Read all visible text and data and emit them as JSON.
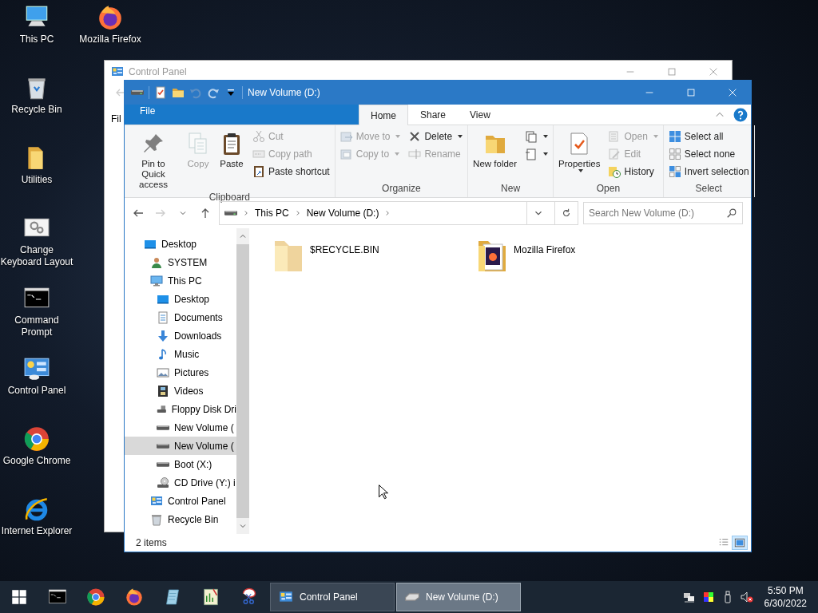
{
  "desktop_icons": [
    {
      "label": "This PC"
    },
    {
      "label": "Recycle Bin"
    },
    {
      "label": "Utilities"
    },
    {
      "label": "Change Keyboard Layout"
    },
    {
      "label": "Command Prompt"
    },
    {
      "label": "Control Panel"
    },
    {
      "label": "Google Chrome"
    },
    {
      "label": "Internet Explorer"
    },
    {
      "label": "Mozilla Firefox"
    }
  ],
  "background_window": {
    "title": "Control Panel",
    "menu_item": "Fil"
  },
  "window": {
    "title": "New Volume (D:)",
    "ribbon": {
      "tabs": [
        {
          "label": "File",
          "kind": "file",
          "selected": false
        },
        {
          "label": "Home",
          "kind": "tab",
          "selected": true
        },
        {
          "label": "Share",
          "kind": "tab",
          "selected": false
        },
        {
          "label": "View",
          "kind": "tab",
          "selected": false
        }
      ],
      "groups": [
        {
          "label": "Clipboard",
          "columns": [
            [
              {
                "label": "Pin to Quick access",
                "kind": "large",
                "disabled": false,
                "menu": false
              }
            ],
            [
              {
                "label": "Copy",
                "kind": "large",
                "disabled": true,
                "menu": false
              }
            ],
            [
              {
                "label": "Paste",
                "kind": "large",
                "disabled": false,
                "menu": false
              }
            ],
            [
              {
                "label": "Cut",
                "kind": "small",
                "disabled": true,
                "menu": false
              },
              {
                "label": "Copy path",
                "kind": "small",
                "disabled": true,
                "menu": false
              },
              {
                "label": "Paste shortcut",
                "kind": "small",
                "disabled": false,
                "menu": false
              }
            ]
          ]
        },
        {
          "label": "Organize",
          "columns": [
            [
              {
                "label": "Move to",
                "kind": "small",
                "disabled": true,
                "menu": true
              },
              {
                "label": "Copy to",
                "kind": "small",
                "disabled": true,
                "menu": true
              }
            ],
            [
              {
                "label": "Delete",
                "kind": "small",
                "disabled": false,
                "menu": true
              },
              {
                "label": "Rename",
                "kind": "small",
                "disabled": true,
                "menu": false
              }
            ]
          ]
        },
        {
          "label": "New",
          "columns": [
            [
              {
                "label": "New folder",
                "kind": "large",
                "disabled": false,
                "menu": false
              }
            ],
            [
              {
                "kind": "icon",
                "disabled": false,
                "menu": true
              },
              {
                "kind": "icon",
                "disabled": false,
                "menu": true
              }
            ]
          ]
        },
        {
          "label": "Open",
          "columns": [
            [
              {
                "label": "Properties",
                "kind": "large",
                "disabled": false,
                "menu": true
              }
            ],
            [
              {
                "label": "Open",
                "kind": "small",
                "disabled": true,
                "menu": true
              },
              {
                "label": "Edit",
                "kind": "small",
                "disabled": true,
                "menu": false
              },
              {
                "label": "History",
                "kind": "small",
                "disabled": false,
                "menu": false
              }
            ]
          ]
        },
        {
          "label": "Select",
          "columns": [
            [
              {
                "label": "Select all",
                "kind": "small",
                "disabled": false,
                "menu": false
              },
              {
                "label": "Select none",
                "kind": "small",
                "disabled": false,
                "menu": false
              },
              {
                "label": "Invert selection",
                "kind": "small",
                "disabled": false,
                "menu": false
              }
            ]
          ]
        }
      ]
    },
    "address": {
      "crumbs": [
        "This PC",
        "New Volume (D:)"
      ],
      "search": {
        "placeholder": "Search New Volume (D:)"
      }
    },
    "nav": {
      "items": [
        {
          "label": "Desktop",
          "selected": false,
          "children": [
            {
              "label": "SYSTEM",
              "selected": false
            },
            {
              "label": "This PC",
              "selected": false,
              "children": [
                {
                  "label": "Desktop",
                  "selected": false
                },
                {
                  "label": "Documents",
                  "selected": false
                },
                {
                  "label": "Downloads",
                  "selected": false
                },
                {
                  "label": "Music",
                  "selected": false
                },
                {
                  "label": "Pictures",
                  "selected": false
                },
                {
                  "label": "Videos",
                  "selected": false
                },
                {
                  "label": "Floppy Disk Dri",
                  "selected": false
                },
                {
                  "label": "New Volume (",
                  "selected": false
                },
                {
                  "label": "New Volume (",
                  "selected": true
                },
                {
                  "label": "Boot (X:)",
                  "selected": false
                },
                {
                  "label": "CD Drive (Y:) i",
                  "selected": false
                }
              ]
            },
            {
              "label": "Control Panel",
              "selected": false
            },
            {
              "label": "Recycle Bin",
              "selected": false
            }
          ]
        }
      ]
    },
    "files": [
      {
        "name": "$RECYCLE.BIN",
        "hidden": true
      },
      {
        "name": "Mozilla Firefox",
        "hidden": false
      }
    ],
    "status_bar": {
      "text": "2 items",
      "views": [
        {
          "selected": false
        },
        {
          "selected": true
        }
      ]
    }
  },
  "taskbar": {
    "tasks": [
      {
        "label": "Control Panel",
        "selected": false
      },
      {
        "label": "New Volume (D:)",
        "selected": true
      }
    ],
    "clock": {
      "time": "5:50 PM",
      "date": "6/30/2022"
    }
  }
}
